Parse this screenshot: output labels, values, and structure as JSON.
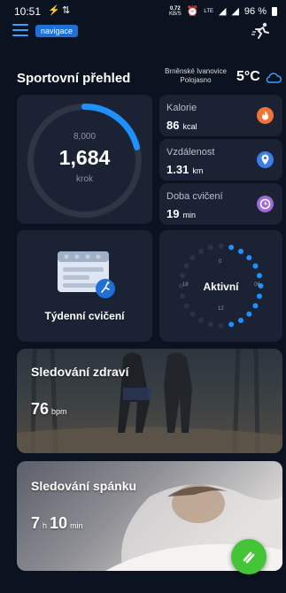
{
  "status_bar": {
    "time": "10:51",
    "speed_top": "0.72",
    "speed_bottom": "KB/S",
    "lte": "LTE",
    "battery": "96 %"
  },
  "header": {
    "nav_badge": "navigace",
    "title": "Sportovní přehled",
    "location_line1": "Brněnské Ivanovice",
    "location_line2": "Polojasno",
    "temperature": "5°C"
  },
  "steps": {
    "goal": "8,000",
    "value": "1,684",
    "unit": "krok",
    "progress": 0.21
  },
  "metrics": [
    {
      "label": "Kalorie",
      "value": "86",
      "unit": "kcal",
      "icon": "fire-icon",
      "color": "#f27335"
    },
    {
      "label": "Vzdálenost",
      "value": "1.31",
      "unit": "km",
      "icon": "location-pin-icon",
      "color": "#3b7ee6"
    },
    {
      "label": "Doba cvičení",
      "value": "19",
      "unit": "min",
      "icon": "clock-icon",
      "color": "#9d6ad9"
    }
  ],
  "weekly": {
    "label": "Týdenní cvičení"
  },
  "activity": {
    "label": "Aktivní",
    "ticks": [
      "0",
      "06",
      "12",
      "18"
    ]
  },
  "health": {
    "title": "Sledování zdraví",
    "value": "76",
    "unit": "bpm"
  },
  "sleep": {
    "title": "Sledování spánku",
    "hours": "7",
    "hours_unit": "h",
    "minutes": "10",
    "minutes_unit": "min"
  },
  "colors": {
    "accent": "#1f6fd8",
    "ring": "#1e90ff",
    "fab": "#44c436"
  }
}
